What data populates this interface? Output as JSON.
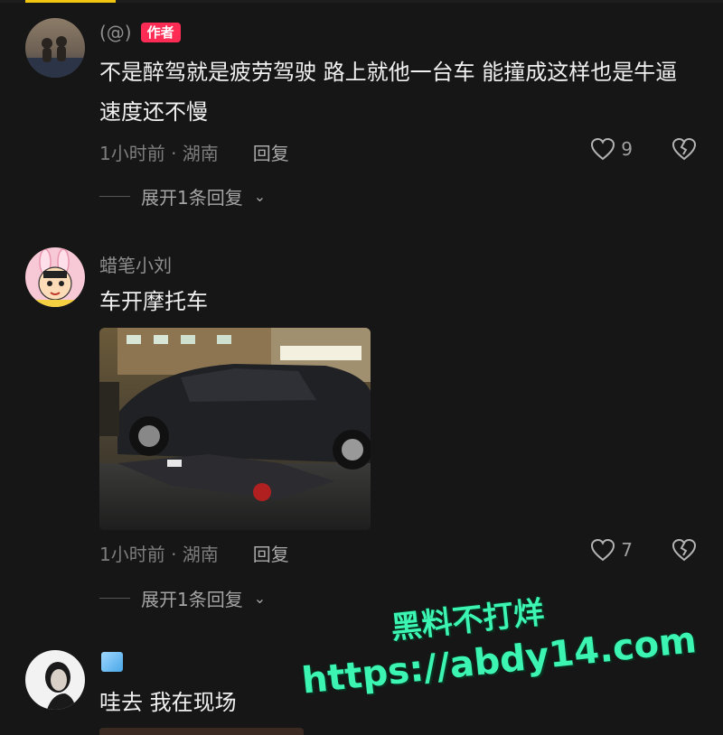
{
  "comments": [
    {
      "username": "(@)",
      "badge": "作者",
      "content": "不是醉驾就是疲劳驾驶 路上就他一台车 能撞成这样也是牛逼 速度还不慢",
      "time_location": "1小时前 · 湖南",
      "reply_label": "回复",
      "likes": "9",
      "expand_label": "展开1条回复"
    },
    {
      "username": "蜡笔小刘",
      "content": "车开摩托车",
      "time_location": "1小时前 · 湖南",
      "reply_label": "回复",
      "likes": "7",
      "expand_label": "展开1条回复"
    },
    {
      "username": "",
      "content": "哇去 我在现场"
    }
  ],
  "watermark": {
    "line1": "黑料不打烊",
    "line2": "https://abdy14.com"
  },
  "colors": {
    "background": "#161616",
    "accent_tab": "#f1c40f",
    "author_badge": "#fe2c55",
    "watermark": "#3df5b2"
  }
}
